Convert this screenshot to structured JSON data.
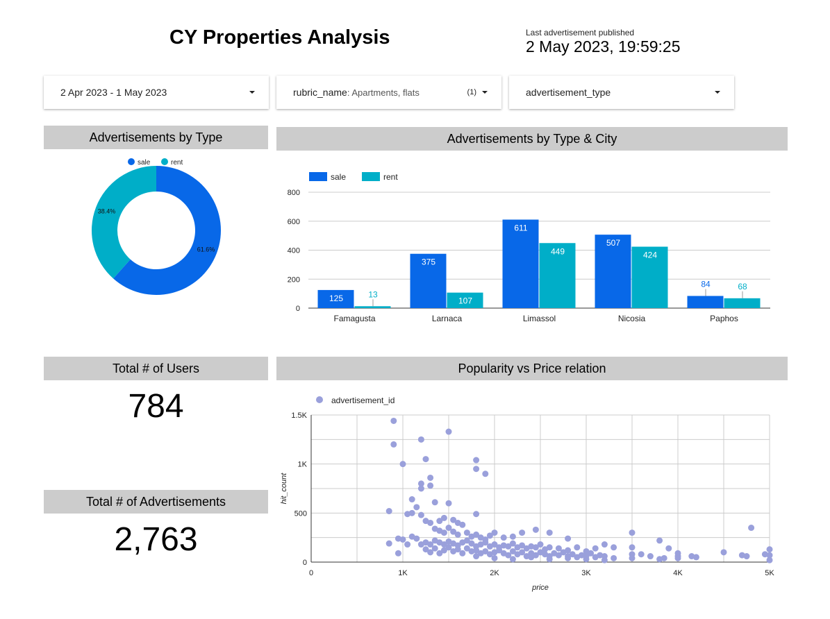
{
  "title": "CY Properties Analysis",
  "last_published": {
    "label": "Last advertisement published",
    "value": "2 May 2023, 19:59:25"
  },
  "filters": {
    "date_range": "2 Apr 2023 - 1 May 2023",
    "rubric": {
      "name": "rubric_name",
      "value": ": Apartments, flats",
      "count": "(1)"
    },
    "advertisement_type": "advertisement_type"
  },
  "colors": {
    "sale": "#0868e8",
    "rent": "#00aec8",
    "scatter": "#9aa0db",
    "header_bg": "#cccccc"
  },
  "panels": {
    "by_type": "Advertisements by Type",
    "by_type_city": "Advertisements by Type & City",
    "users": "Total # of Users",
    "ads": "Total # of Advertisements",
    "popularity": "Popularity vs Price relation"
  },
  "kpis": {
    "users": "784",
    "advertisements": "2,763"
  },
  "chart_data": [
    {
      "type": "pie",
      "donut": true,
      "legend_position": "top",
      "slices": [
        {
          "name": "sale",
          "value": 61.6,
          "label": "61.6%",
          "color": "#0868e8"
        },
        {
          "name": "rent",
          "value": 38.4,
          "label": "38.4%",
          "color": "#00aec8"
        }
      ]
    },
    {
      "type": "bar",
      "legend_position": "top-left",
      "categories": [
        "Famagusta",
        "Larnaca",
        "Limassol",
        "Nicosia",
        "Paphos"
      ],
      "series": [
        {
          "name": "sale",
          "values": [
            125,
            375,
            611,
            507,
            84
          ],
          "color": "#0868e8"
        },
        {
          "name": "rent",
          "values": [
            13,
            107,
            449,
            424,
            68
          ],
          "color": "#00aec8"
        }
      ],
      "ylim": [
        0,
        800
      ],
      "yticks": [
        "0",
        "200",
        "400",
        "600",
        "800"
      ],
      "grid": true
    },
    {
      "type": "scatter",
      "legend_position": "top-left",
      "series_name": "advertisement_id",
      "xlabel": "price",
      "ylabel": "hit_count",
      "xlim": [
        0,
        5000
      ],
      "ylim": [
        0,
        1500
      ],
      "xticks": [
        "0",
        "1K",
        "2K",
        "3K",
        "4K",
        "5K"
      ],
      "yticks": [
        "0",
        "500",
        "1K",
        "1.5K"
      ],
      "grid": true,
      "points": [
        [
          900,
          1440
        ],
        [
          900,
          1200
        ],
        [
          1200,
          1250
        ],
        [
          1500,
          1330
        ],
        [
          1000,
          1000
        ],
        [
          1250,
          1050
        ],
        [
          1800,
          1040
        ],
        [
          1800,
          950
        ],
        [
          1900,
          900
        ],
        [
          1200,
          800
        ],
        [
          1300,
          860
        ],
        [
          1300,
          780
        ],
        [
          1200,
          750
        ],
        [
          1100,
          640
        ],
        [
          1350,
          610
        ],
        [
          1500,
          600
        ],
        [
          1150,
          560
        ],
        [
          1800,
          490
        ],
        [
          1050,
          490
        ],
        [
          1100,
          500
        ],
        [
          1200,
          480
        ],
        [
          850,
          520
        ],
        [
          1250,
          420
        ],
        [
          1300,
          400
        ],
        [
          1400,
          420
        ],
        [
          1450,
          450
        ],
        [
          1550,
          430
        ],
        [
          1600,
          400
        ],
        [
          1650,
          380
        ],
        [
          1500,
          350
        ],
        [
          1350,
          340
        ],
        [
          1400,
          320
        ],
        [
          1450,
          300
        ],
        [
          1550,
          310
        ],
        [
          1600,
          280
        ],
        [
          1700,
          300
        ],
        [
          1750,
          260
        ],
        [
          1800,
          280
        ],
        [
          1850,
          250
        ],
        [
          1900,
          230
        ],
        [
          1950,
          270
        ],
        [
          2000,
          300
        ],
        [
          2100,
          250
        ],
        [
          2200,
          260
        ],
        [
          2300,
          300
        ],
        [
          2450,
          330
        ],
        [
          2600,
          300
        ],
        [
          2800,
          240
        ],
        [
          1100,
          260
        ],
        [
          1150,
          240
        ],
        [
          1250,
          200
        ],
        [
          1300,
          180
        ],
        [
          1350,
          220
        ],
        [
          1400,
          200
        ],
        [
          1450,
          180
        ],
        [
          1500,
          210
        ],
        [
          1550,
          190
        ],
        [
          1600,
          170
        ],
        [
          1650,
          200
        ],
        [
          1700,
          220
        ],
        [
          1750,
          190
        ],
        [
          1800,
          160
        ],
        [
          1850,
          180
        ],
        [
          1900,
          200
        ],
        [
          1950,
          160
        ],
        [
          2000,
          180
        ],
        [
          2050,
          150
        ],
        [
          2100,
          170
        ],
        [
          2150,
          160
        ],
        [
          2200,
          190
        ],
        [
          2250,
          150
        ],
        [
          2300,
          170
        ],
        [
          2350,
          140
        ],
        [
          2400,
          160
        ],
        [
          2450,
          150
        ],
        [
          2500,
          180
        ],
        [
          2550,
          130
        ],
        [
          2600,
          150
        ],
        [
          2700,
          140
        ],
        [
          2800,
          120
        ],
        [
          2900,
          150
        ],
        [
          3000,
          110
        ],
        [
          3100,
          140
        ],
        [
          3200,
          180
        ],
        [
          3300,
          150
        ],
        [
          3500,
          300
        ],
        [
          3500,
          150
        ],
        [
          3800,
          220
        ],
        [
          3900,
          140
        ],
        [
          4000,
          90
        ],
        [
          4200,
          50
        ],
        [
          4500,
          100
        ],
        [
          4700,
          70
        ],
        [
          4800,
          350
        ],
        [
          4950,
          80
        ],
        [
          5000,
          130
        ],
        [
          5000,
          70
        ],
        [
          4000,
          60
        ],
        [
          3600,
          80
        ],
        [
          850,
          190
        ],
        [
          950,
          240
        ],
        [
          1000,
          230
        ],
        [
          1050,
          180
        ],
        [
          950,
          90
        ],
        [
          1200,
          180
        ],
        [
          1250,
          130
        ],
        [
          1300,
          100
        ],
        [
          1350,
          140
        ],
        [
          1400,
          90
        ],
        [
          1450,
          120
        ],
        [
          1500,
          150
        ],
        [
          1550,
          110
        ],
        [
          1600,
          130
        ],
        [
          1650,
          90
        ],
        [
          1700,
          140
        ],
        [
          1750,
          110
        ],
        [
          1800,
          120
        ],
        [
          1850,
          90
        ],
        [
          1900,
          110
        ],
        [
          1950,
          80
        ],
        [
          2000,
          100
        ],
        [
          2050,
          120
        ],
        [
          2100,
          90
        ],
        [
          2150,
          70
        ],
        [
          2200,
          110
        ],
        [
          2250,
          80
        ],
        [
          2300,
          100
        ],
        [
          2350,
          60
        ],
        [
          2400,
          90
        ],
        [
          2450,
          70
        ],
        [
          2500,
          100
        ],
        [
          2550,
          80
        ],
        [
          2600,
          60
        ],
        [
          2650,
          90
        ],
        [
          2700,
          70
        ],
        [
          2750,
          100
        ],
        [
          2800,
          60
        ],
        [
          2850,
          80
        ],
        [
          2900,
          50
        ],
        [
          2950,
          70
        ],
        [
          3000,
          60
        ],
        [
          3050,
          90
        ],
        [
          3100,
          50
        ],
        [
          3150,
          70
        ],
        [
          3200,
          60
        ],
        [
          3300,
          40
        ],
        [
          3500,
          80
        ],
        [
          3700,
          60
        ],
        [
          3850,
          40
        ],
        [
          4150,
          60
        ],
        [
          4750,
          60
        ],
        [
          5000,
          20
        ],
        [
          1800,
          60
        ],
        [
          2000,
          40
        ],
        [
          2200,
          30
        ],
        [
          2400,
          50
        ],
        [
          2600,
          30
        ],
        [
          2800,
          40
        ],
        [
          3000,
          30
        ],
        [
          3200,
          20
        ],
        [
          3500,
          40
        ],
        [
          3800,
          30
        ],
        [
          4000,
          40
        ]
      ]
    }
  ]
}
